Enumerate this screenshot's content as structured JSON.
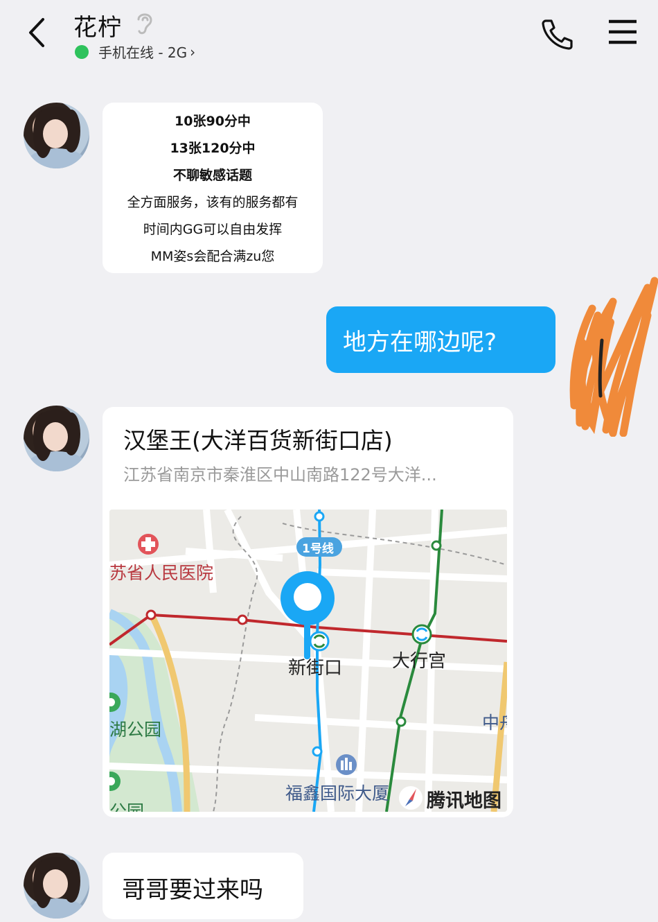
{
  "header": {
    "title": "花柠",
    "status": "手机在线 - 2G",
    "status_chevron": "›",
    "icons": {
      "back": "back-arrow-icon",
      "listen": "ear-icon",
      "call": "phone-icon",
      "menu": "menu-icon"
    },
    "online_color": "#2ec25c"
  },
  "messages": {
    "m1": {
      "lines": [
        "10张90分中",
        "13张120分中",
        "不聊敏感话题",
        "全方面服务，该有的服务都有",
        "时间内GG可以自由发挥",
        "MM姿s会配合满zu您"
      ]
    },
    "m2": {
      "text": "地方在哪边呢?"
    },
    "location": {
      "name": "汉堡王(大洋百货新街口店)",
      "address": "江苏省南京市秦淮区中山南路122号大洋...",
      "map": {
        "labels": {
          "hospital": "苏省人民医院",
          "line1": "1号线",
          "xinjiekou": "新街口",
          "daxinggong": "大行宫",
          "park1": "湖公园",
          "park2": "公园",
          "fuxin": "福鑫国际大厦",
          "zhong": "中舟",
          "brand": "腾讯地图"
        }
      }
    },
    "m4": {
      "text": "哥哥要过来吗"
    }
  },
  "colors": {
    "accent_bubble": "#1aa7f5",
    "background": "#f0f0f3",
    "metro_red": "#c0282d",
    "metro_green": "#2a8a3d",
    "metro_blue": "#1aa7f5"
  }
}
